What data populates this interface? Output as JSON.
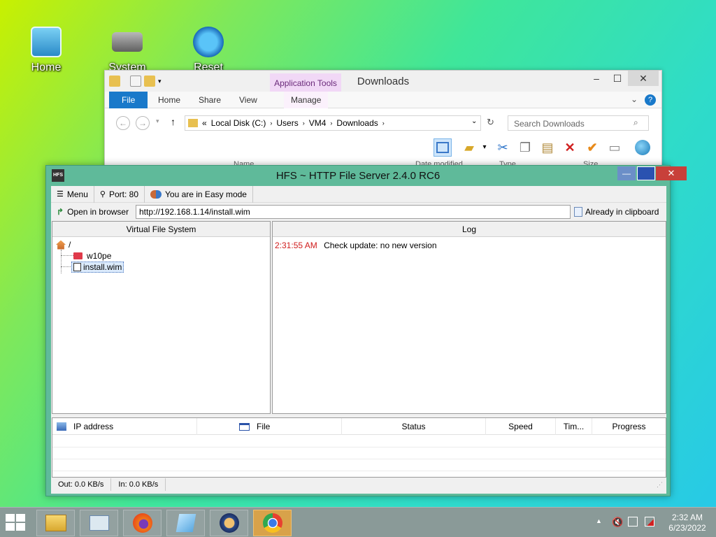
{
  "desktop": {
    "icons": [
      {
        "label": "Home",
        "icon": "home-icon"
      },
      {
        "label": "System",
        "icon": "drive-icon"
      },
      {
        "label": "Reset",
        "icon": "refresh-icon"
      }
    ]
  },
  "explorer": {
    "title": "Downloads",
    "app_tools": "Application Tools",
    "tabs": {
      "file": "File",
      "home": "Home",
      "share": "Share",
      "view": "View",
      "manage": "Manage"
    },
    "address": {
      "prefix": "«",
      "parts": [
        "Local Disk (C:)",
        "Users",
        "VM4",
        "Downloads"
      ]
    },
    "search_placeholder": "Search Downloads",
    "columns": {
      "name": "Name",
      "date": "Date modified",
      "type": "Type",
      "size": "Size"
    }
  },
  "hfs": {
    "title": "HFS ~ HTTP File Server 2.4.0 RC6",
    "logo": "HFS",
    "toolbar": {
      "menu": "Menu",
      "port": "Port: 80",
      "mode": "You are in Easy mode",
      "open_browser": "Open in browser",
      "url": "http://192.168.1.14/install.wim",
      "clipboard": "Already in clipboard"
    },
    "vfs": {
      "header": "Virtual File System",
      "root": "/",
      "items": [
        {
          "label": "w10pe",
          "icon": "folder-icon"
        },
        {
          "label": "install.wim",
          "icon": "file-icon"
        }
      ]
    },
    "log": {
      "header": "Log",
      "entries": [
        {
          "time": "2:31:55 AM",
          "message": "Check update: no new version"
        }
      ]
    },
    "connections": {
      "columns": {
        "ip": "IP address",
        "file": "File",
        "status": "Status",
        "speed": "Speed",
        "time": "Tim...",
        "progress": "Progress"
      }
    },
    "status": {
      "out": "Out: 0.0 KB/s",
      "in": "In: 0.0 KB/s"
    }
  },
  "taskbar": {
    "clock_time": "2:32 AM",
    "clock_date": "6/23/2022",
    "apps": [
      "start-icon",
      "file-explorer-icon",
      "task-manager-icon",
      "firefox-icon",
      "notepad-icon",
      "hfs-icon",
      "chrome-icon"
    ]
  },
  "colors": {
    "log_time": "#d01c1c",
    "file_tab": "#1979ca",
    "hfs_frame": "#5fba9a",
    "close_button": "#c8403a"
  }
}
